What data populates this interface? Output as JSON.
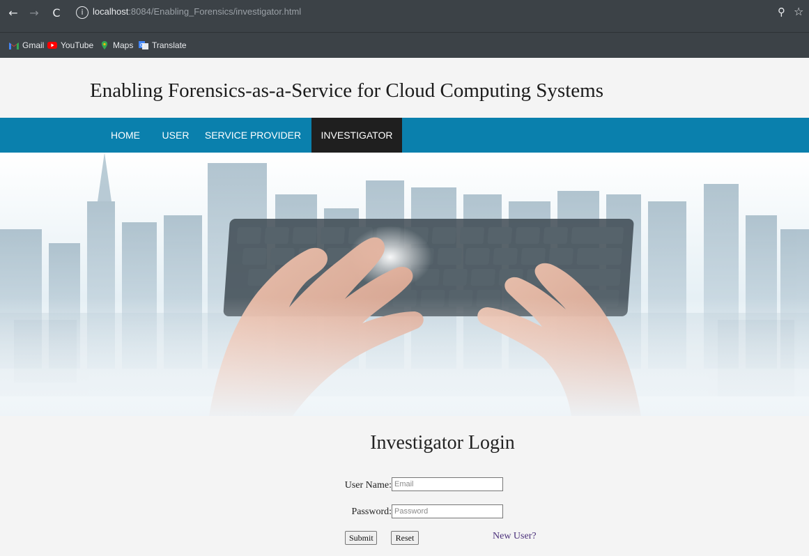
{
  "browser": {
    "url_host": "localhost",
    "url_rest": ":8084/Enabling_Forensics/investigator.html",
    "bookmarks": [
      {
        "label": "Gmail",
        "icon": "gmail-icon"
      },
      {
        "label": "YouTube",
        "icon": "youtube-icon"
      },
      {
        "label": "Maps",
        "icon": "maps-icon"
      },
      {
        "label": "Translate",
        "icon": "translate-icon"
      }
    ]
  },
  "site": {
    "title": "Enabling Forensics-as-a-Service for Cloud Computing Systems",
    "nav": [
      "HOME",
      "USER",
      "SERVICE PROVIDER",
      "INVESTIGATOR"
    ],
    "active_nav": "INVESTIGATOR"
  },
  "hero": {
    "image": "city-skyline-keyboard-hands"
  },
  "login": {
    "title": "Investigator Login",
    "username_label": "User Name:",
    "username_placeholder": "Email",
    "password_label": "Password:",
    "password_placeholder": "Password",
    "submit_label": "Submit",
    "reset_label": "Reset",
    "new_user_label": "New User?"
  },
  "colors": {
    "nav_bg": "#0a80ad",
    "nav_active": "#1f1f1f",
    "chrome": "#3c4247"
  }
}
